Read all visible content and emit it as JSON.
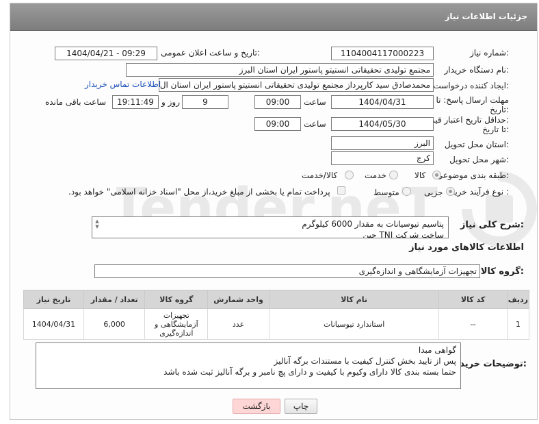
{
  "header": {
    "title": "جزئیات اطلاعات نیاز"
  },
  "fields": {
    "need_number_label": "شماره نیاز:",
    "need_number": "1104004117000223",
    "announce_label": "تاریخ و ساعت اعلان عمومی:",
    "announce_value": "1404/04/21 - 09:29",
    "buyer_label": "نام دستگاه خریدار:",
    "buyer_value": "مجتمع تولیدی تحقیقاتی انستیتو پاستور ایران استان البرز",
    "creator_label": "ایجاد کننده درخواست:",
    "creator_value": "محمدصادق سید کارپرداز مجتمع تولیدی تحقیقاتی انستیتو پاستور ایران استان ال",
    "contact_link": "اطلاعات تماس خریدار",
    "deadline_label_1": "مهلت ارسال پاسخ: تا",
    "deadline_label_2": "تاریخ:",
    "deadline_date": "1404/04/31",
    "time_label": "ساعت",
    "deadline_time": "09:00",
    "days_value": "9",
    "days_label": "روز و",
    "remaining_time": "19:11:49",
    "remaining_label": "ساعت باقی مانده",
    "min_price_label_1": "حداقل تاریخ اعتبار قیمت:",
    "min_price_label_2": "تا تاریخ:",
    "min_price_date": "1404/05/30",
    "min_price_time": "09:00",
    "province_label": "استان محل تحویل:",
    "province_value": "البرز",
    "city_label": "شهر محل تحویل:",
    "city_value": "کرج",
    "category_label": "طبقه بندی موضوعی:",
    "category_options": [
      "کالا",
      "خدمت",
      "کالا/خدمت"
    ],
    "process_label": "نوع فرآیند خرید :",
    "process_options": [
      "جزیی",
      "متوسط"
    ],
    "payment_note": "پرداخت تمام یا بخشی از مبلغ خرید،از محل \"اسناد خزانه اسلامی\" خواهد بود.",
    "description_label": "شرح کلی نیاز:",
    "description_line1": "پتاسیم تیوسیانات به مقدار 6000 کیلوگرم",
    "description_line2": "ساخت شرکت TNJ  چین",
    "goods_info_title": "اطلاعات کالاهای مورد نیاز",
    "goods_group_label": "گروه کالا:",
    "goods_group_value": "تجهیزات آزمایشگاهی و اندازه‌گیری"
  },
  "table": {
    "headers": [
      "ردیف",
      "کد کالا",
      "نام کالا",
      "واحد شمارش",
      "گروه کالا",
      "تعداد / مقدار",
      "تاریخ نیاز"
    ],
    "rows": [
      [
        "1",
        "--",
        "استاندارد تیوسیانات",
        "عدد",
        "تجهیزات آزمایشگاهی و اندازه‌گیری",
        "6,000",
        "1404/04/31"
      ]
    ]
  },
  "buyer_notes": {
    "label": "توضیحات خریدار:",
    "line1": "گواهی مبدا",
    "line2": "پس از تایید بخش کنترل کیفیت با مستندات برگه آنالیز",
    "line3": "حتما بسته بندی کالا دارای وکیوم با کیفیت و دارای پچ نامبر و برگه آنالیز ثبت شده باشد"
  },
  "buttons": {
    "print": "چاپ",
    "back": "بازگشت"
  },
  "watermark": "AriaTender.neT",
  "colors": {
    "header_bg": "#8a8a8a",
    "link": "#1a4fb8",
    "back_button": "#ffd6d6"
  }
}
